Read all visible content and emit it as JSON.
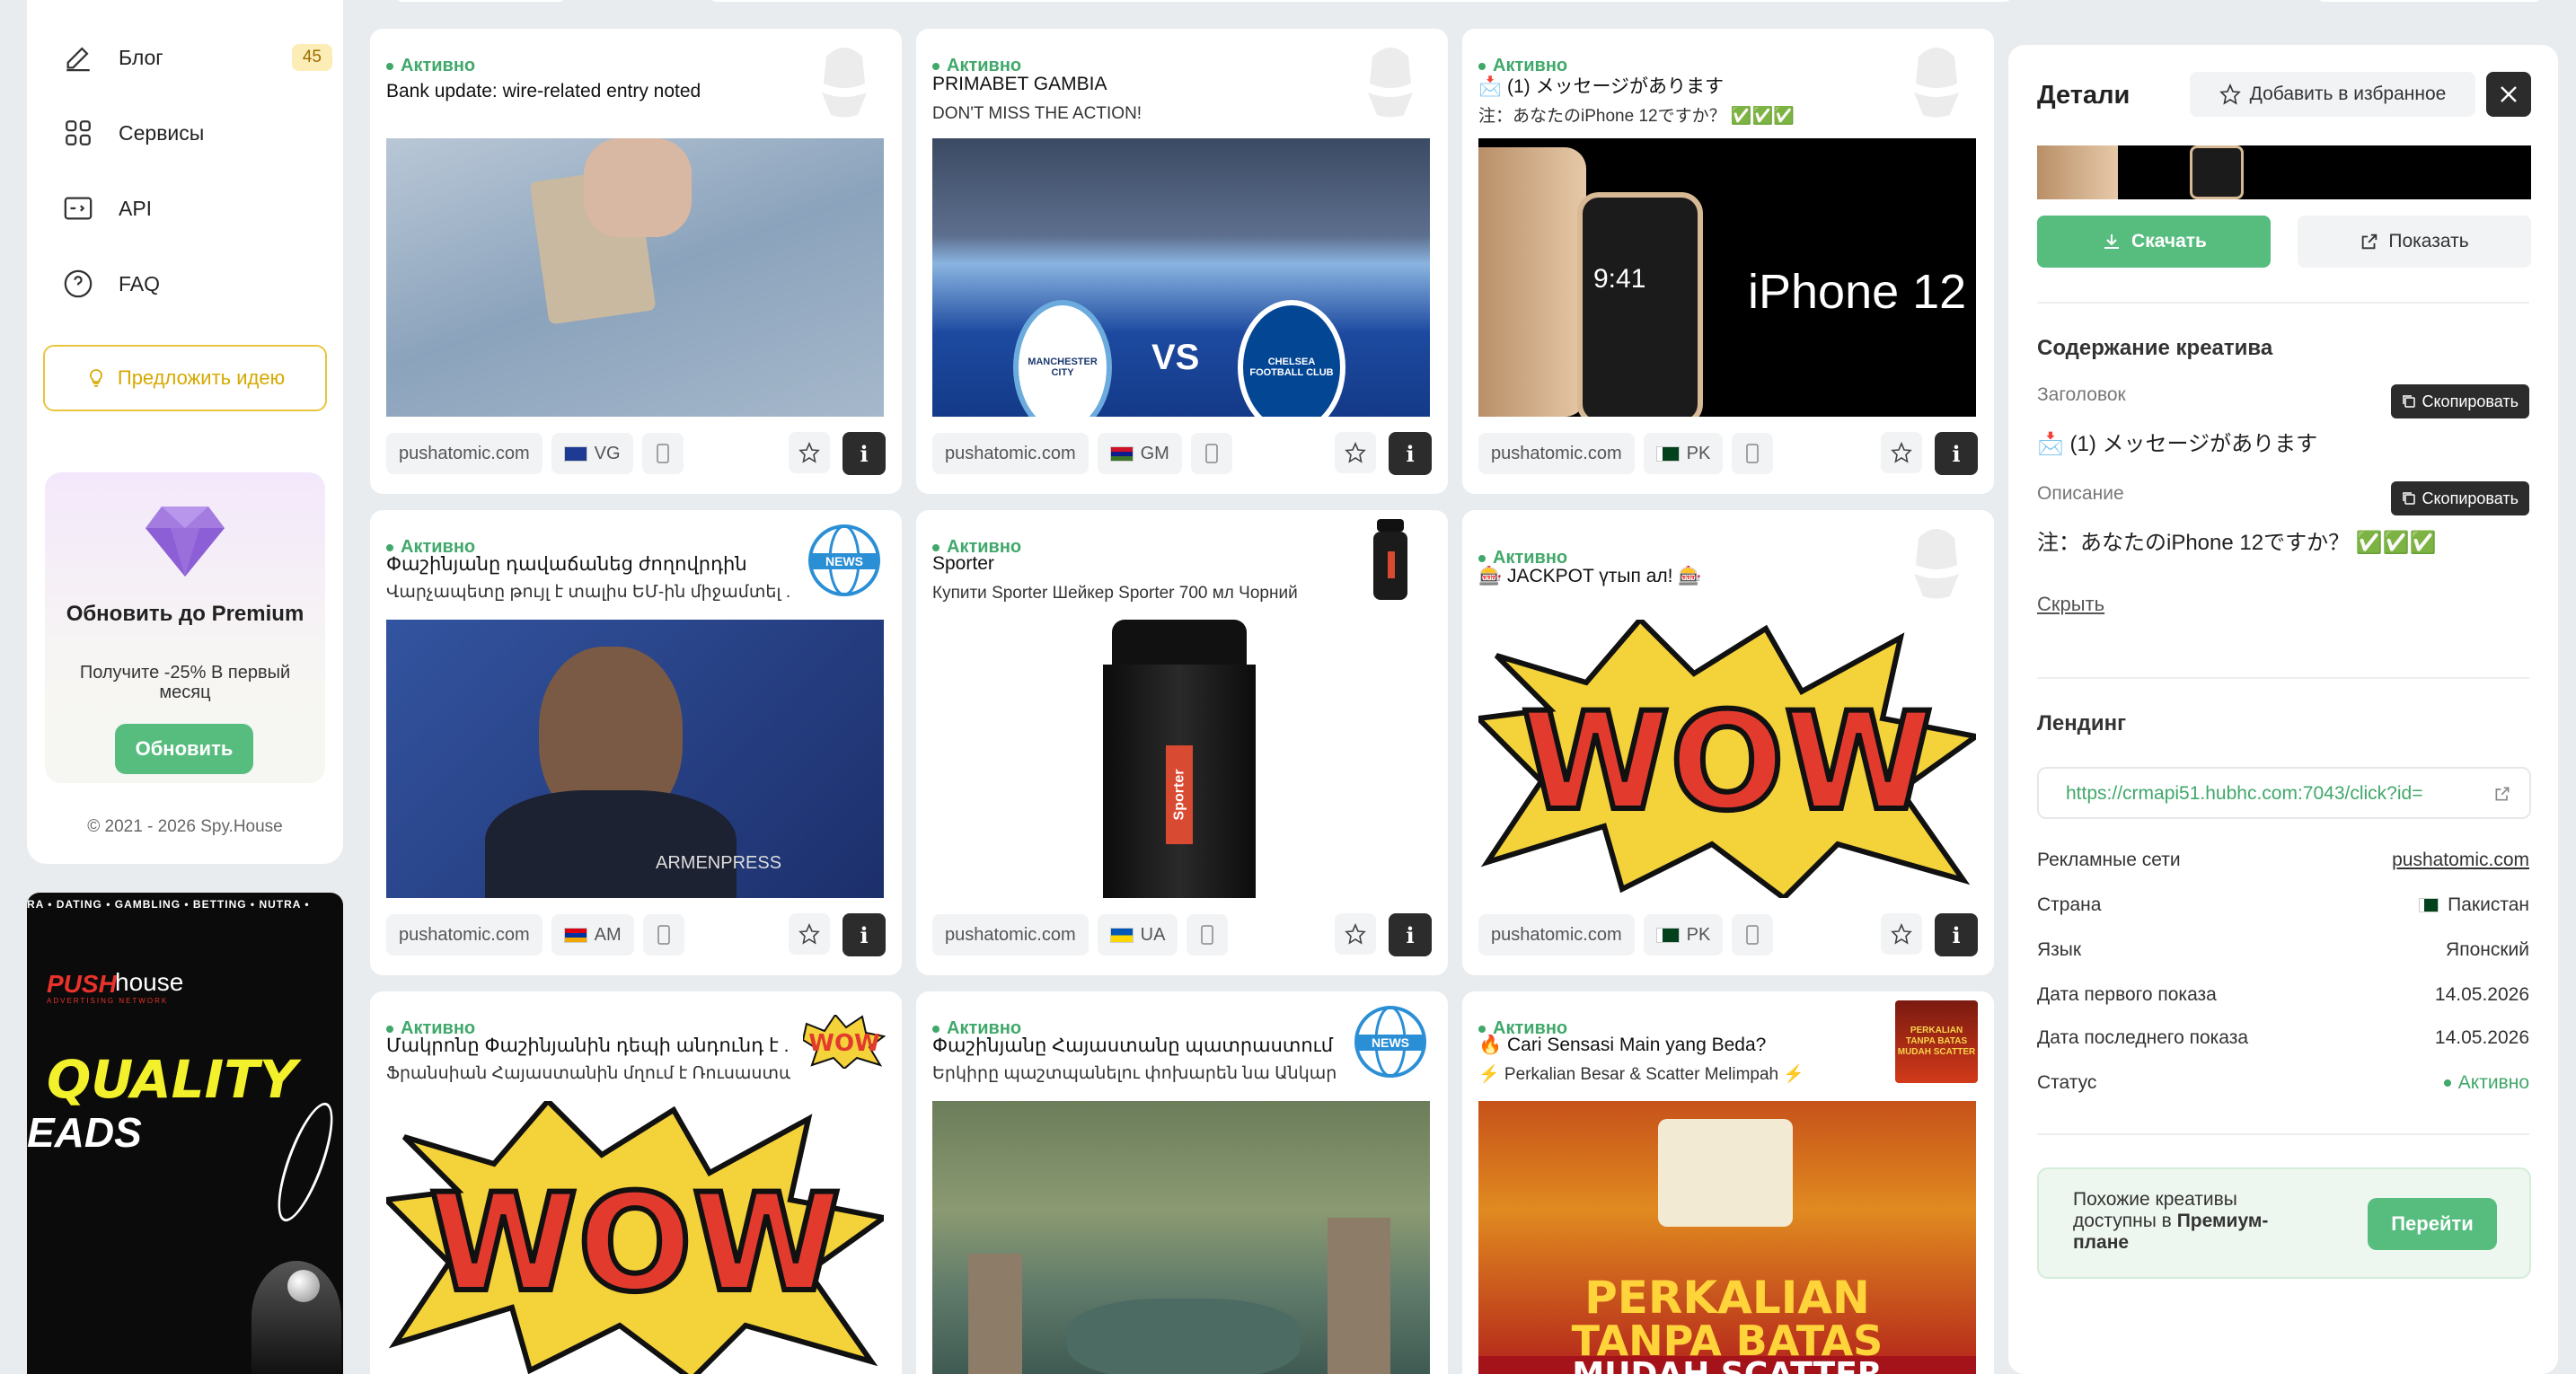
{
  "sidebar": {
    "items": [
      {
        "label": "Блог",
        "badge": "45",
        "icon": "pencil-icon"
      },
      {
        "label": "Сервисы",
        "icon": "grid-icon"
      },
      {
        "label": "API",
        "icon": "api-icon"
      },
      {
        "label": "FAQ",
        "icon": "question-icon"
      }
    ],
    "idea_button": "Предложить идею",
    "premium": {
      "title": "Обновить до Premium",
      "subtitle": "Получите -25% В первый месяц",
      "button": "Обновить"
    },
    "copyright": "© 2021 - 2026 Spy.House"
  },
  "ad_banner": {
    "ticker": "RA • DATING • GAMBLING • BETTING • NUTRA •",
    "brand_push": "PUSH",
    "brand_house": "house",
    "brand_tagline": "ADVERTISING NETWORK",
    "headline1": "QUALITY",
    "headline2": "EADS"
  },
  "cards": [
    {
      "status": "Активно",
      "title": "Bank update: wire-related entry noted",
      "subtitle": "",
      "domain": "pushatomic.com",
      "country": "VG"
    },
    {
      "status": "Активно",
      "title": "PRIMABET GAMBIA",
      "subtitle": "DON'T MISS THE ACTION!",
      "domain": "pushatomic.com",
      "country": "GM",
      "img_text": {
        "vs": "VS",
        "left": "MANCHESTER CITY",
        "right": "CHELSEA FOOTBALL CLUB"
      }
    },
    {
      "status": "Активно",
      "title": "📩 (1) メッセージがあります",
      "subtitle": "注：あなたのiPhone 12ですか？ ✅✅✅",
      "domain": "pushatomic.com",
      "country": "PK",
      "img_text": {
        "time": "9:41",
        "brand": "iPhone 12"
      }
    },
    {
      "status": "Активно",
      "title": "Փաշինյանը դավաճանեց ժողովրդին",
      "subtitle": "Վարչապետը թույլ է տալիս ԵՄ-ին միջամտել ...",
      "domain": "pushatomic.com",
      "country": "AM",
      "img_text": {
        "watermark": "ARMENPRESS",
        "thumb": "NEWS"
      }
    },
    {
      "status": "Активно",
      "title": "Sporter",
      "subtitle": "Купити Sporter Шейкер Sporter 700 мл Чорний",
      "domain": "pushatomic.com",
      "country": "UA",
      "img_text": {
        "bottle": "Sporter"
      }
    },
    {
      "status": "Активно",
      "title": "🎰 JACKPOT үтып ал! 🎰",
      "subtitle": "",
      "domain": "pushatomic.com",
      "country": "PK",
      "img_text": {
        "wow": "WOW"
      }
    },
    {
      "status": "Активно",
      "title": "Մակրոնը Փաշինյանին դեպի անդունդ է ...",
      "subtitle": "Ֆրանսիան Հայաստանին մղում է Ռուսաստա...",
      "domain": "",
      "country": "",
      "img_text": {
        "wow": "WOW"
      }
    },
    {
      "status": "Активно",
      "title": "Փաշինյանը Հայաստանը պատրաստում ...",
      "subtitle": "Երկիրը պաշտպանելու փոխարեն նա Անկար...",
      "domain": "",
      "country": "",
      "img_text": {
        "thumb": "NEWS"
      }
    },
    {
      "status": "Активно",
      "title": "🔥 Cari Sensasi Main yang Beda?",
      "subtitle": "⚡ Perkalian Besar & Scatter Melimpah ⚡",
      "domain": "",
      "country": "",
      "img_text": {
        "line1": "PERKALIAN",
        "line2": "TANPA BATAS",
        "line3": "MUDAH SCATTER",
        "thumb": "PERKALIAN TANPA BATAS MUDAH SCATTER"
      }
    }
  ],
  "details": {
    "title": "Детали",
    "favorite_button": "Добавить в избранное",
    "download_button": "Скачать",
    "show_button": "Показать",
    "content_title": "Содержание креатива",
    "headline_label": "Заголовок",
    "headline_value": "📩 (1) メッセージがあります",
    "description_label": "Описание",
    "description_value": "注：あなたのiPhone 12ですか？ ✅✅✅",
    "copy_button": "Скопировать",
    "hide_link": "Скрыть",
    "landing_title": "Лендинг",
    "landing_url": "https://crmapi51.hubhc.com:7043/click?id=",
    "rows": [
      {
        "label": "Рекламные сети",
        "value": "pushatomic.com"
      },
      {
        "label": "Страна",
        "value": "Пакистан"
      },
      {
        "label": "Язык",
        "value": "Японский"
      },
      {
        "label": "Дата первого показа",
        "value": "14.05.2026"
      },
      {
        "label": "Дата последнего показа",
        "value": "14.05.2026"
      },
      {
        "label": "Статус",
        "value": "Активно"
      }
    ],
    "similar_text_1": "Похожие креативы доступны в",
    "similar_text_bold": "Премиум-плане",
    "similar_button": "Перейти"
  },
  "colors": {
    "accent_green": "#56bd7f",
    "status_green": "#40a86a",
    "badge_yellow": "#fbedb5",
    "dark_button": "#2c2c2c"
  }
}
